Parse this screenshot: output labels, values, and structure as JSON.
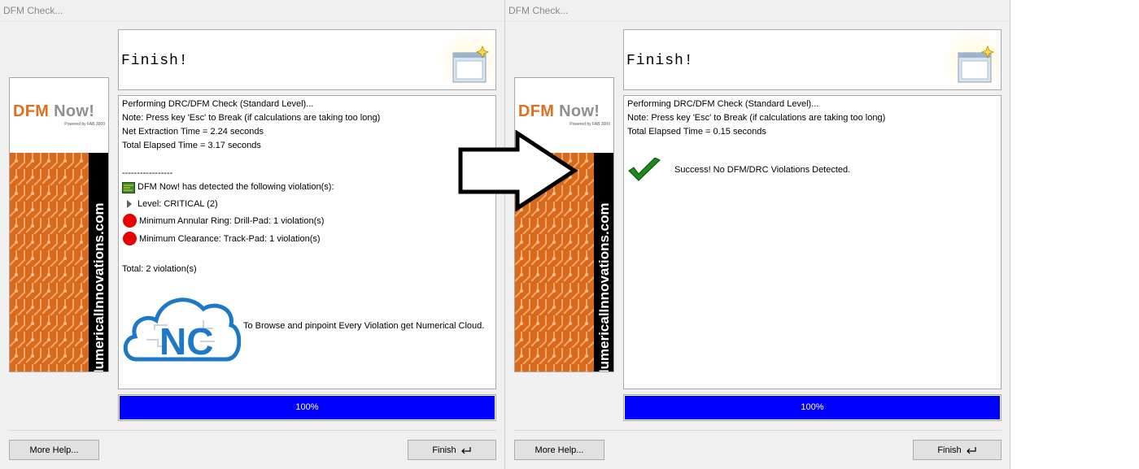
{
  "dialogs": [
    {
      "title": "DFM Check...",
      "header": "Finish!",
      "banner": {
        "brand_dfm": "DFM",
        "brand_now": "Now!",
        "powered": "Powered by FAB 3000",
        "vertical": "NumericalInnovations.com"
      },
      "lines": [
        "Performing DRC/DFM Check (Standard Level)...",
        "Note:  Press key 'Esc' to Break  (if calculations are taking too long)",
        "Net Extraction Time = 2.24 seconds",
        "Total Elapsed Time = 3.17 seconds",
        "-----------------"
      ],
      "detected": "DFM Now! has detected the following violation(s):",
      "level": "Level: CRITICAL (2)",
      "violations": [
        "Minimum Annular Ring: Drill-Pad: 1 violation(s)",
        "Minimum Clearance: Track-Pad: 1 violation(s)"
      ],
      "total": "Total: 2 violation(s)",
      "cloud_logo_text": "NC",
      "cloud_text": "To Browse and pinpoint Every Violation get Numerical Cloud.",
      "progress": {
        "label": "100%",
        "value": 1.0
      },
      "more_help": "More Help...",
      "finish": "Finish"
    },
    {
      "title": "DFM Check...",
      "header": "Finish!",
      "banner": {
        "brand_dfm": "DFM",
        "brand_now": "Now!",
        "powered": "Powered by FAB 3000",
        "vertical": "NumericalInnovations.com"
      },
      "lines": [
        "Performing DRC/DFM Check (Standard Level)...",
        "Note:  Press key 'Esc' to Break  (if calculations are taking too long)",
        "Total Elapsed Time = 0.15 seconds"
      ],
      "success": "Success!  No DFM/DRC Violations Detected.",
      "progress": {
        "label": "100%",
        "value": 1.0
      },
      "more_help": "More Help...",
      "finish": "Finish"
    }
  ],
  "colors": {
    "progress": "#0000ff",
    "violation": "#e80000",
    "check": "#1c8a1c",
    "brand_orange": "#e07020"
  },
  "icons": [
    "wizard-icon",
    "violation-icon",
    "expand-triangle-icon",
    "pcb-icon",
    "check-icon",
    "enter-key-icon",
    "right-arrow-icon",
    "numerical-cloud-logo"
  ]
}
